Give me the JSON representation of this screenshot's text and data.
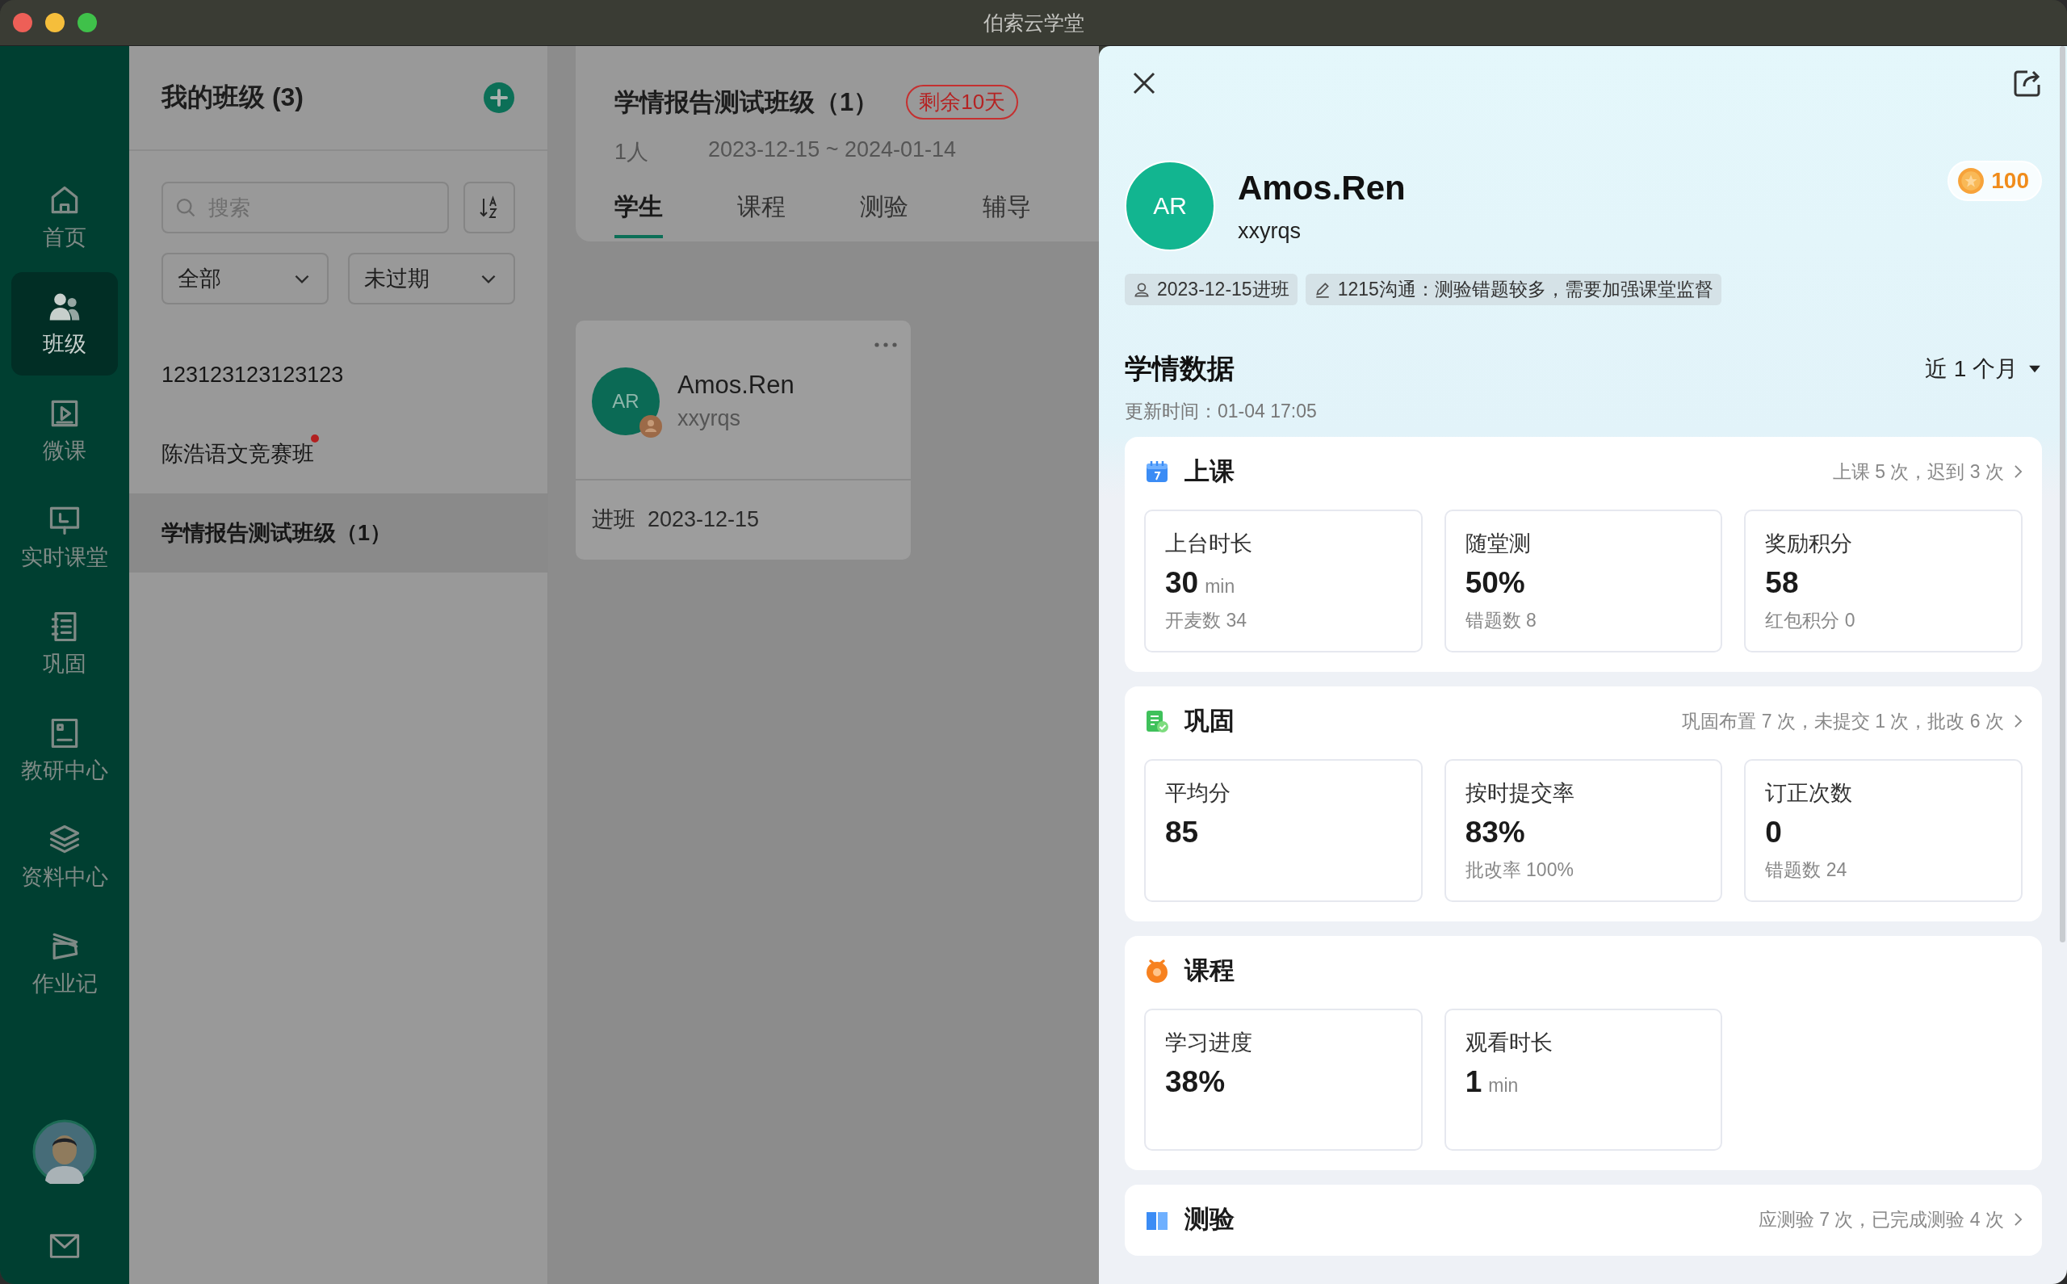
{
  "window": {
    "title": "伯索云学堂"
  },
  "sidebar": {
    "items": [
      {
        "label": "首页",
        "selected": false
      },
      {
        "label": "班级",
        "selected": true
      },
      {
        "label": "微课",
        "selected": false
      },
      {
        "label": "实时课堂",
        "selected": false
      },
      {
        "label": "巩固",
        "selected": false
      },
      {
        "label": "教研中心",
        "selected": false
      },
      {
        "label": "资料中心",
        "selected": false
      },
      {
        "label": "作业记",
        "selected": false
      }
    ]
  },
  "class_list": {
    "title": "我的班级 (3)",
    "search": {
      "placeholder": "搜索"
    },
    "filters": [
      "全部",
      "未过期"
    ],
    "classes": [
      {
        "name": "123123123123123",
        "selected": false,
        "unread": false
      },
      {
        "name": "陈浩语文竞赛班",
        "selected": false,
        "unread": true
      },
      {
        "name": "学情报告测试班级（1）",
        "selected": true,
        "unread": false
      }
    ]
  },
  "class_detail": {
    "title": "学情报告测试班级（1）",
    "remaining": "剩余10天",
    "members": "1人",
    "period": "2023-12-15 ~ 2024-01-14",
    "tabs": [
      {
        "label": "学生",
        "selected": true
      },
      {
        "label": "课程",
        "selected": false
      },
      {
        "label": "测验",
        "selected": false
      },
      {
        "label": "辅导",
        "selected": false
      }
    ],
    "students": [
      {
        "initials": "AR",
        "name": "Amos.Ren",
        "account": "xxyrqs",
        "joined": "进班  2023-12-15"
      }
    ]
  },
  "student_panel": {
    "initials": "AR",
    "name": "Amos.Ren",
    "account": "xxyrqs",
    "points": "100",
    "tags": [
      {
        "kind": "joined",
        "text": "2023-12-15进班"
      },
      {
        "kind": "note",
        "text": "1215沟通：测验错题较多，需要加强课堂监督"
      }
    ],
    "report": {
      "title": "学情数据",
      "range": "近 1 个月",
      "updated": "更新时间：01-04 17:05",
      "sections": [
        {
          "kind": "class",
          "title": "上课",
          "summary": "上课 5 次，迟到 3 次",
          "stats": [
            {
              "label": "上台时长",
              "value": "30",
              "unit": "min",
              "detail": "开麦数 34"
            },
            {
              "label": "随堂测",
              "value": "50%",
              "detail": "错题数 8"
            },
            {
              "label": "奖励积分",
              "value": "58",
              "detail": "红包积分 0"
            }
          ]
        },
        {
          "kind": "practice",
          "title": "巩固",
          "summary": "巩固布置 7 次，未提交 1 次，批改 6 次",
          "stats": [
            {
              "label": "平均分",
              "value": "85"
            },
            {
              "label": "按时提交率",
              "value": "83%",
              "detail": "批改率 100%"
            },
            {
              "label": "订正次数",
              "value": "0",
              "detail": "错题数 24"
            }
          ]
        },
        {
          "kind": "course",
          "title": "课程",
          "stats": [
            {
              "label": "学习进度",
              "value": "38%"
            },
            {
              "label": "观看时长",
              "value": "1",
              "unit": "min"
            }
          ]
        },
        {
          "kind": "quiz",
          "title": "测验",
          "summary": "应测验 7 次，已完成测验 4 次"
        }
      ]
    }
  }
}
